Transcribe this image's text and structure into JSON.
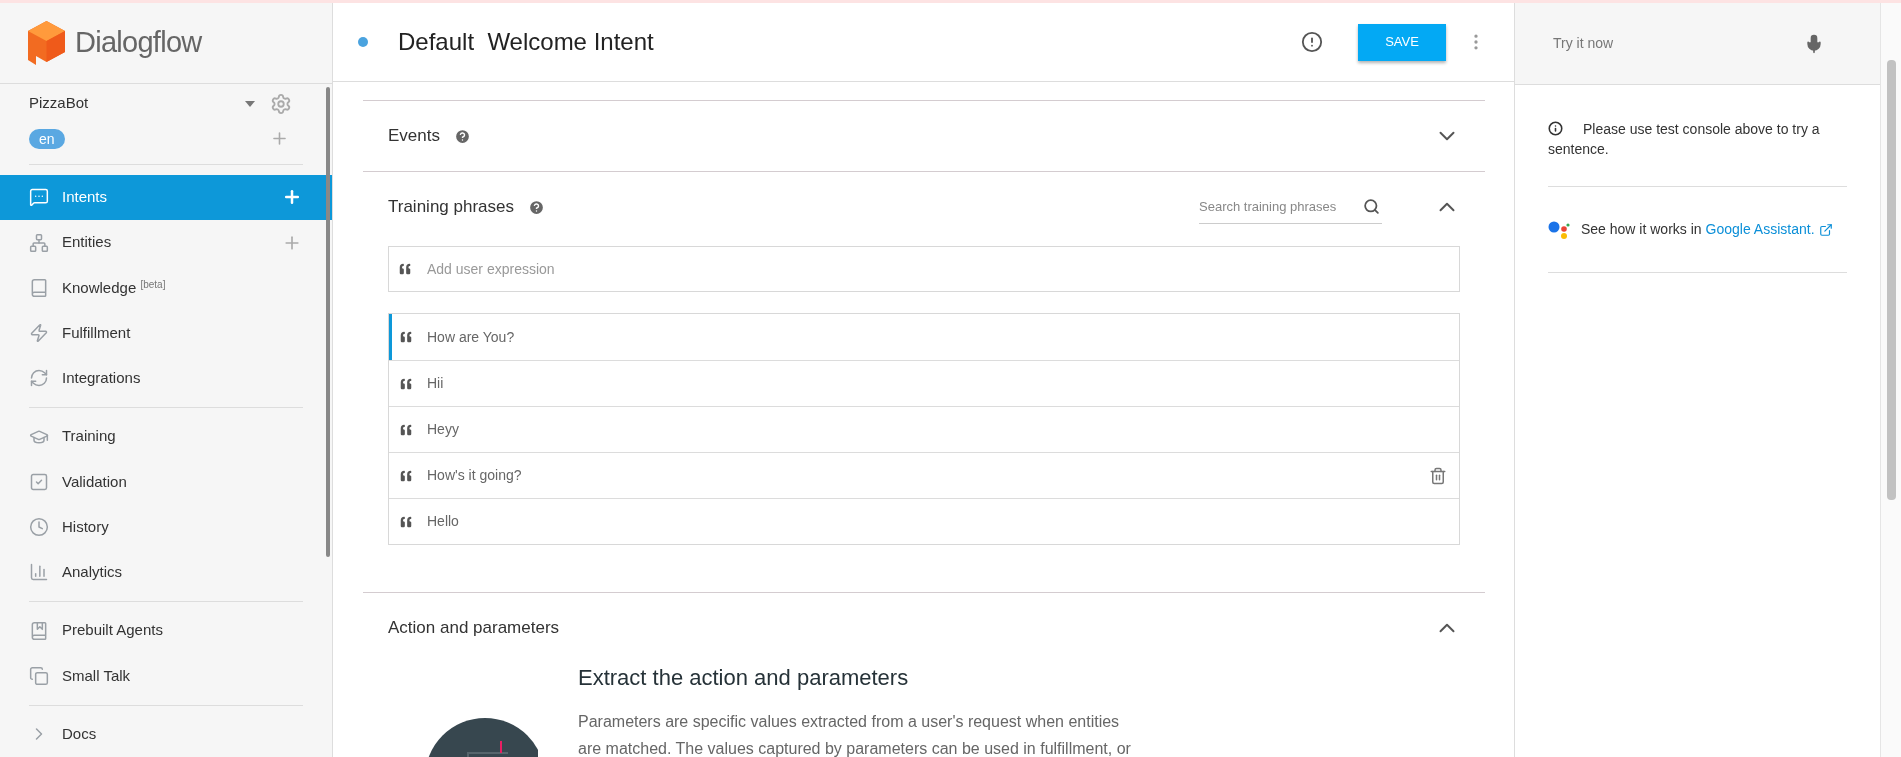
{
  "sidebar": {
    "logo": "Dialogflow",
    "agent": "PizzaBot",
    "language": "en",
    "groups": [
      [
        {
          "label": "Intents",
          "selected": true,
          "add_button": true
        },
        {
          "label": "Entities",
          "selected": false,
          "add_button": true
        },
        {
          "label": "Knowledge $^{[beta]}$",
          "selected": false,
          "add_button": false
        },
        {
          "label": "Fulfillment",
          "selected": false,
          "add_button": false
        },
        {
          "label": "Integrations",
          "selected": false,
          "add_button": false
        }
      ],
      [
        {
          "label": "Training",
          "selected": false,
          "add_button": false
        },
        {
          "label": "Validation",
          "selected": false,
          "add_button": false
        },
        {
          "label": "History",
          "selected": false,
          "add_button": false
        },
        {
          "label": "Analytics",
          "selected": false,
          "add_button": false
        }
      ],
      [
        {
          "label": "Prebuilt Agents",
          "selected": false,
          "add_button": false
        },
        {
          "label": "Small Talk",
          "selected": false,
          "add_button": false
        }
      ],
      [
        {
          "label": "Docs",
          "selected": false,
          "add_button": false
        }
      ]
    ]
  },
  "intent": {
    "title": "Default  Welcome Intent",
    "save_button": "SAVE"
  },
  "sections": [
    {
      "kind": "events",
      "title": "Events",
      "expanded": false
    },
    {
      "kind": "training",
      "title": "Training phrases",
      "expanded": true,
      "search_placeholder": "Search training phrases",
      "input_placeholder": "Add user expression",
      "phrases": [
        {
          "text": "How are You?",
          "selected": true,
          "hovered": false
        },
        {
          "text": "Hii",
          "selected": false,
          "hovered": false
        },
        {
          "text": "Heyy",
          "selected": false,
          "hovered": false
        },
        {
          "text": "How's it going?",
          "selected": false,
          "hovered": true
        },
        {
          "text": "Hello",
          "selected": false,
          "hovered": false
        }
      ]
    },
    {
      "kind": "action",
      "title": "Action and parameters",
      "expanded": true,
      "heading": "Extract the action and parameters",
      "paragraph": "Parameters are specific values extracted from a user's request when entities are matched. The values captured by parameters can be used in fulfillment, or"
    }
  ],
  "test_panel": {
    "placeholder": "Try it now",
    "info": "Please use test console above to try a sentence.",
    "assistant_text": "See how it works in",
    "assistant_link": "Google Assistant."
  }
}
